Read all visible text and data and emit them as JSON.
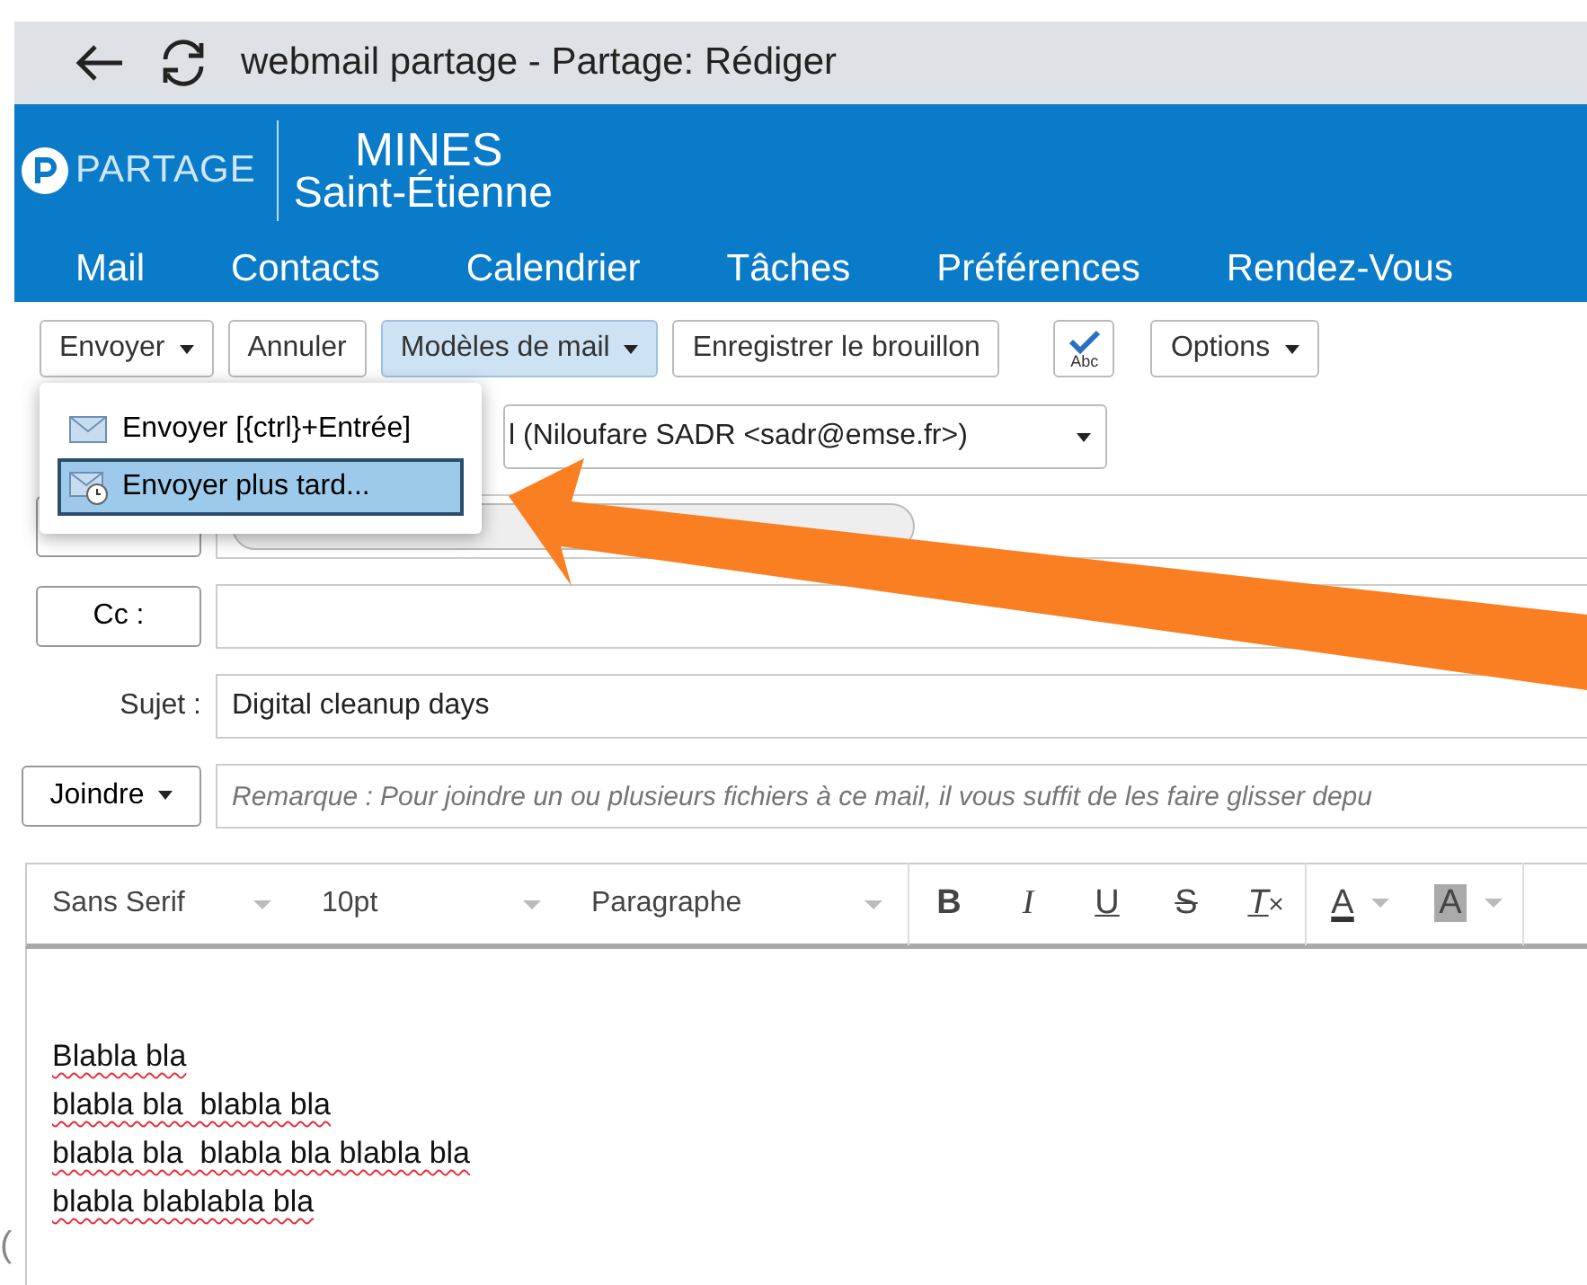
{
  "browser": {
    "title": "webmail partage - Partage: Rédiger"
  },
  "header": {
    "brand": "PARTAGE",
    "school_top": "MINES",
    "school_bottom": "Saint-Étienne"
  },
  "nav": [
    {
      "label": "Mail"
    },
    {
      "label": "Contacts"
    },
    {
      "label": "Calendrier"
    },
    {
      "label": "Tâches"
    },
    {
      "label": "Préférences"
    },
    {
      "label": "Rendez-Vous"
    }
  ],
  "toolbar": [
    {
      "kind": "button",
      "label": "Envoyer",
      "dropdown": true,
      "highlighted": false
    },
    {
      "kind": "button",
      "label": "Annuler",
      "dropdown": false,
      "highlighted": false
    },
    {
      "kind": "button",
      "label": "Modèles de mail",
      "dropdown": true,
      "highlighted": true
    },
    {
      "kind": "button",
      "label": "Enregistrer le brouillon",
      "dropdown": false,
      "highlighted": false
    },
    {
      "kind": "spellcheck",
      "label": "Abc"
    },
    {
      "kind": "button",
      "label": "Options",
      "dropdown": true,
      "highlighted": false
    }
  ],
  "send_menu": [
    {
      "label": "Envoyer [{ctrl}+Entrée]",
      "selected": false
    },
    {
      "label": "Envoyer plus tard...",
      "selected": true
    }
  ],
  "from": {
    "value": "l (Niloufare SADR <sadr@emse.fr>)"
  },
  "cc": {
    "label": "Cc :"
  },
  "subject": {
    "label": "Sujet :",
    "value": "Digital cleanup days"
  },
  "attach": {
    "label": "Joindre",
    "placeholder": "Remarque : Pour joindre un ou plusieurs fichiers à ce mail, il vous suffit de les faire glisser depu"
  },
  "editor_toolbar": {
    "selects": [
      "Sans Serif",
      "10pt",
      "Paragraphe"
    ],
    "buttons": [
      {
        "kind": "bold",
        "label": "B"
      },
      {
        "kind": "italic",
        "label": "I"
      },
      {
        "kind": "underline",
        "label": "U"
      },
      {
        "kind": "strike",
        "label": "S"
      },
      {
        "kind": "clear",
        "label": "T"
      },
      {
        "kind": "color",
        "label": "A"
      },
      {
        "kind": "background",
        "label": "A"
      }
    ]
  },
  "body": [
    "Blabla bla",
    "blabla bla  blabla bla",
    "blabla bla  blabla bla blabla bla",
    "blabla blablabla bla"
  ],
  "edge_mark": "("
}
